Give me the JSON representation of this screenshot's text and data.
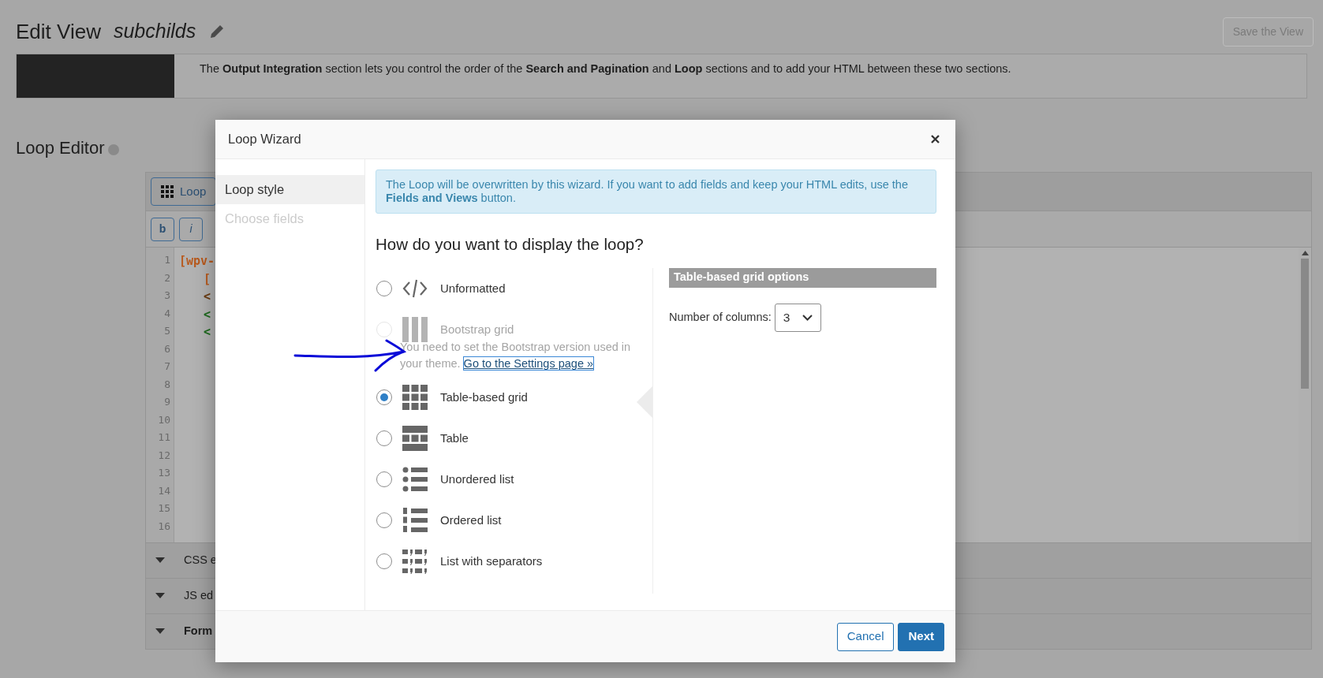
{
  "page": {
    "title": "Edit View",
    "view_name": "subchilds",
    "save_button": "Save the View"
  },
  "notice": {
    "text": "The **Output Integration** section lets you control the order of the **Search and Pagination** and **Loop** sections and to add your HTML between these two sections."
  },
  "loop_editor": {
    "title": "Loop Editor",
    "toolbar_button": "Loop",
    "format_buttons": [
      "b",
      "i"
    ],
    "code_lines": [
      {
        "number": "1",
        "text": "[wpv-",
        "color": "#b85a1e"
      },
      {
        "number": "2",
        "text": "[",
        "color": "#b85a1e",
        "indented": true
      },
      {
        "number": "3",
        "text": "<",
        "color": "#6b3b10",
        "indented": true
      },
      {
        "number": "4",
        "text": "<",
        "color": "#1f6b1f",
        "indented": true
      },
      {
        "number": "5",
        "text": "<",
        "color": "#1f6b1f",
        "indented": true
      },
      {
        "number": "6"
      },
      {
        "number": "7"
      },
      {
        "number": "8"
      },
      {
        "number": "9"
      },
      {
        "number": "10"
      },
      {
        "number": "11"
      },
      {
        "number": "12"
      },
      {
        "number": "13"
      },
      {
        "number": "14"
      },
      {
        "number": "15"
      },
      {
        "number": "16"
      }
    ],
    "sections": [
      {
        "label": "CSS e",
        "bold": false
      },
      {
        "label": "JS ed",
        "bold": false
      },
      {
        "label": "Form",
        "bold": true
      }
    ]
  },
  "dialog": {
    "title": "Loop Wizard",
    "steps": [
      {
        "label": "Loop style",
        "selected": true
      },
      {
        "label": "Choose fields",
        "selected": false
      }
    ],
    "info": "The Loop will be overwritten by this wizard. If you want to add fields and keep your HTML edits, use the **Fields and Views** button.",
    "question": "How do you want to display the loop?",
    "options": [
      {
        "kind": "code",
        "label": "Unformatted",
        "selected": false,
        "disabled": false
      },
      {
        "kind": "bootstrap",
        "label": "Bootstrap grid",
        "selected": false,
        "disabled": true,
        "note": "You need to set the Bootstrap version used in your theme.",
        "note_link": "Go to the Settings page »"
      },
      {
        "kind": "table_grid",
        "label": "Table-based grid",
        "selected": true,
        "disabled": false
      },
      {
        "kind": "table",
        "label": "Table",
        "selected": false,
        "disabled": false
      },
      {
        "kind": "unordered",
        "label": "Unordered list",
        "selected": false,
        "disabled": false
      },
      {
        "kind": "ordered",
        "label": "Ordered list",
        "selected": false,
        "disabled": false
      },
      {
        "kind": "separators",
        "label": "List with separators",
        "selected": false,
        "disabled": false
      }
    ],
    "options_panel": {
      "title": "Table-based grid options",
      "field_label": "Number of columns:",
      "value": "3"
    },
    "buttons": [
      {
        "kind": "secondary",
        "label": "Cancel"
      },
      {
        "kind": "primary",
        "label": "Next"
      }
    ]
  }
}
